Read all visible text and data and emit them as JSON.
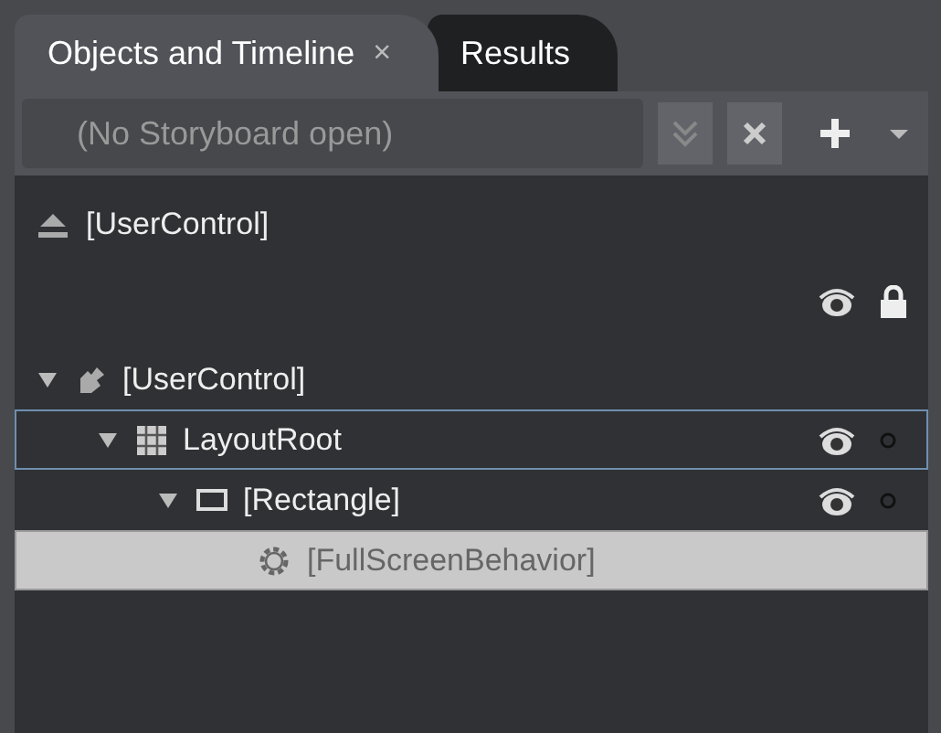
{
  "tabs": [
    {
      "label": "Objects and Timeline",
      "close": "×",
      "selected": true
    },
    {
      "label": "Results",
      "selected": false
    }
  ],
  "storyboard": {
    "placeholder": "(No Storyboard open)"
  },
  "scope": {
    "label": "[UserControl]"
  },
  "header_toggles": {
    "visible": true,
    "locked": true
  },
  "tree": [
    {
      "label": "[UserControl]",
      "kind": "usercontrol",
      "expanded": true,
      "selected": false,
      "focused": false,
      "children": [
        {
          "label": "LayoutRoot",
          "kind": "grid",
          "expanded": true,
          "selected": false,
          "focused": true,
          "visible": true,
          "locked": false,
          "children": [
            {
              "label": "[Rectangle]",
              "kind": "rectangle",
              "expanded": true,
              "selected": false,
              "focused": false,
              "visible": true,
              "locked": false,
              "children": [
                {
                  "label": "[FullScreenBehavior]",
                  "kind": "behavior",
                  "selected": true,
                  "focused": false
                }
              ]
            }
          ]
        }
      ]
    }
  ]
}
